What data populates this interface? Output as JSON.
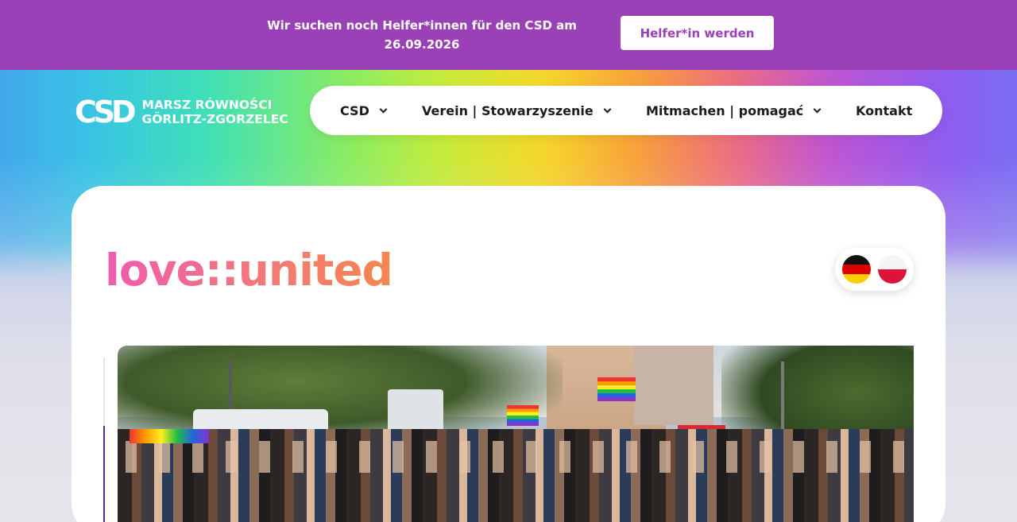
{
  "announcement": {
    "text": "Wir suchen noch Helfer*innen für den CSD am 26.09.2026",
    "button_label": "Helfer*in werden"
  },
  "logo": {
    "mark": "CSD",
    "line1": "MARSZ RÓWNOŚCI",
    "line2": "GÖRLITZ-ZGORZELEC"
  },
  "nav": {
    "items": [
      {
        "label": "CSD",
        "has_dropdown": true
      },
      {
        "label": "Verein | Stowarzyszenie",
        "has_dropdown": true
      },
      {
        "label": "Mitmachen | pomagać",
        "has_dropdown": true
      },
      {
        "label": "Kontakt",
        "has_dropdown": false
      }
    ]
  },
  "hero": {
    "brand": "love::united"
  },
  "language_switch": {
    "languages": [
      "de-flag-icon",
      "pl-flag-icon"
    ]
  },
  "colors": {
    "topbar": "#9b41b8",
    "button_text": "#9b41b8",
    "brand_gradient_start": "#ef5bb0",
    "brand_gradient_end": "#f4864f"
  }
}
